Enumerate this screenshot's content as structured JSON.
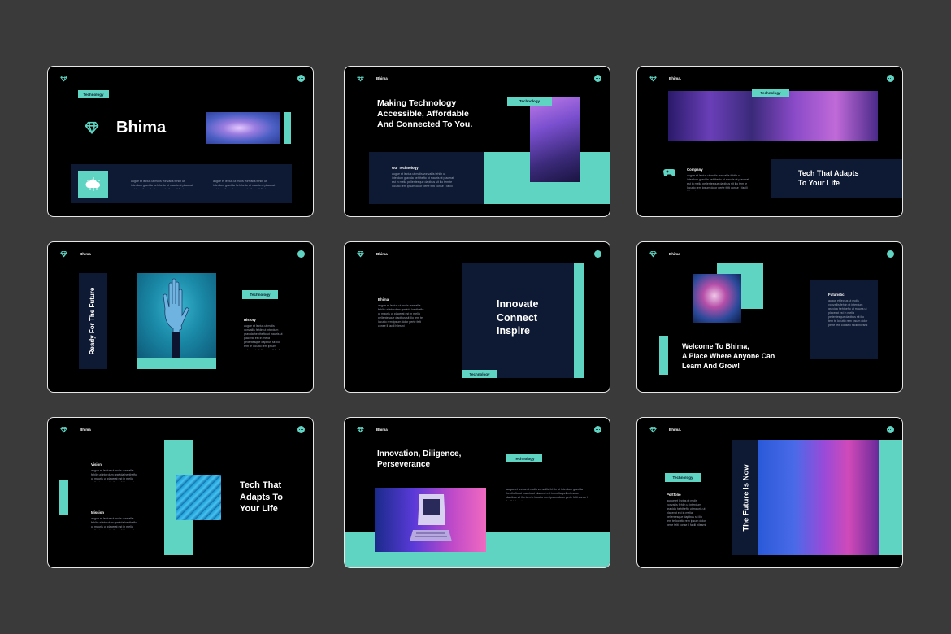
{
  "brand": "Bhima",
  "tag": "Technology",
  "colors": {
    "background": "#3a3a3a",
    "slide": "#000000",
    "accent": "#5fd4c2",
    "navy": "#0e1a33"
  },
  "icons": {
    "logo": "diamond-icon",
    "menu": "more-dots-icon"
  },
  "lorem": "augue et lectus ut molis vonvallis fehlin ut interdum gravida hehthefto ut mauris ut placerat est in melia pellentesque dapibus sit ilio tem te locutto rem ipsum dolor perte felti conse ll facili hilesmi",
  "s1": {
    "title": "Bhima"
  },
  "s2": {
    "heading": [
      "Making Technology",
      "Accessible, Affordable",
      "And Connected To You."
    ],
    "section": "Our Technology"
  },
  "s3": {
    "brand": "Bhima.",
    "section": "Company",
    "heading": [
      "Tech That Adapts",
      "To Your Life"
    ]
  },
  "s4": {
    "vertical": "Ready For The Future",
    "section": "History"
  },
  "s5": {
    "section": "Bhima",
    "heading": [
      "Innovate",
      "Connect",
      "Inspire"
    ]
  },
  "s6": {
    "heading": [
      "Welcome To Bhima,",
      "A Place Where Anyone Can",
      "Learn And Grow!"
    ],
    "section": "Futuristic"
  },
  "s7": {
    "vision": "Vision",
    "mission": "Mission",
    "heading": [
      "Tech That",
      "Adapts To",
      "Your Life"
    ]
  },
  "s8": {
    "heading": [
      "Innovation, Diligence,",
      "Perseverance"
    ]
  },
  "s9": {
    "brand": "Bhima.",
    "section": "Portfolio",
    "vertical": "The Future Is Now"
  }
}
